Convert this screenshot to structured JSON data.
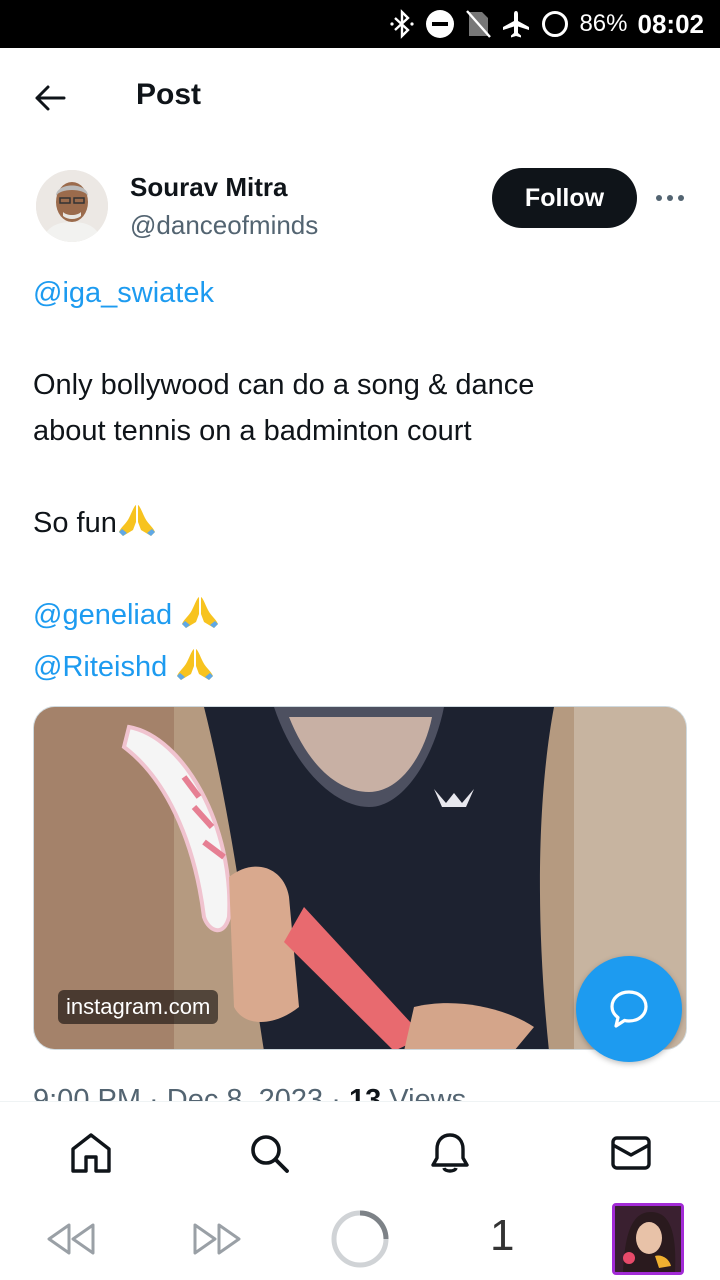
{
  "status_bar": {
    "battery": "86%",
    "time": "08:02",
    "icons": [
      "bluetooth-icon",
      "do-not-disturb-icon",
      "no-sim-icon",
      "airplane-icon",
      "battery-ring-icon"
    ]
  },
  "header": {
    "title": "Post",
    "back_icon": "arrow-left-icon"
  },
  "post": {
    "author_name": "Sourav Mitra",
    "author_handle": "@danceofminds",
    "follow_label": "Follow",
    "mention_1": "@iga_swiatek",
    "line_1": "Only bollywood can do a song & dance",
    "line_2": "about tennis on a badminton court",
    "line_3": "So fun",
    "mention_2": "@geneliad",
    "mention_3": "@Riteishd",
    "media_source": "instagram.com",
    "timestamp": "9:00 PM · Dec 8, 2023 · ",
    "views_count": "13",
    "views_label": " Views"
  },
  "bottom_nav": {
    "items": [
      "home-icon",
      "search-icon",
      "notifications-icon",
      "messages-icon"
    ]
  },
  "system_nav": {
    "count": "1"
  },
  "colors": {
    "accent": "#1d9bf0",
    "text": "#0f1419",
    "secondary": "#536471",
    "follow_bg": "#0f1419"
  }
}
